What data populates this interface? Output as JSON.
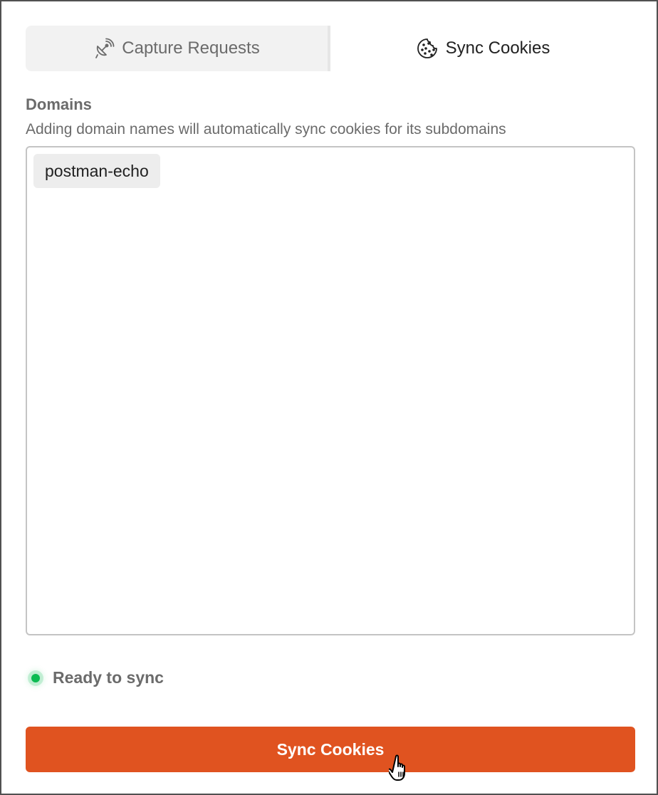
{
  "tabs": [
    {
      "label": "Capture Requests",
      "icon": "satellite-dish-icon",
      "active": false
    },
    {
      "label": "Sync Cookies",
      "icon": "cookie-icon",
      "active": true
    }
  ],
  "domains": {
    "title": "Domains",
    "description": "Adding domain names will automatically sync cookies for its subdomains",
    "items": [
      "postman-echo"
    ]
  },
  "status": {
    "text": "Ready to sync",
    "color": "#0cbb52"
  },
  "action": {
    "label": "Sync Cookies",
    "color": "#e05320"
  }
}
